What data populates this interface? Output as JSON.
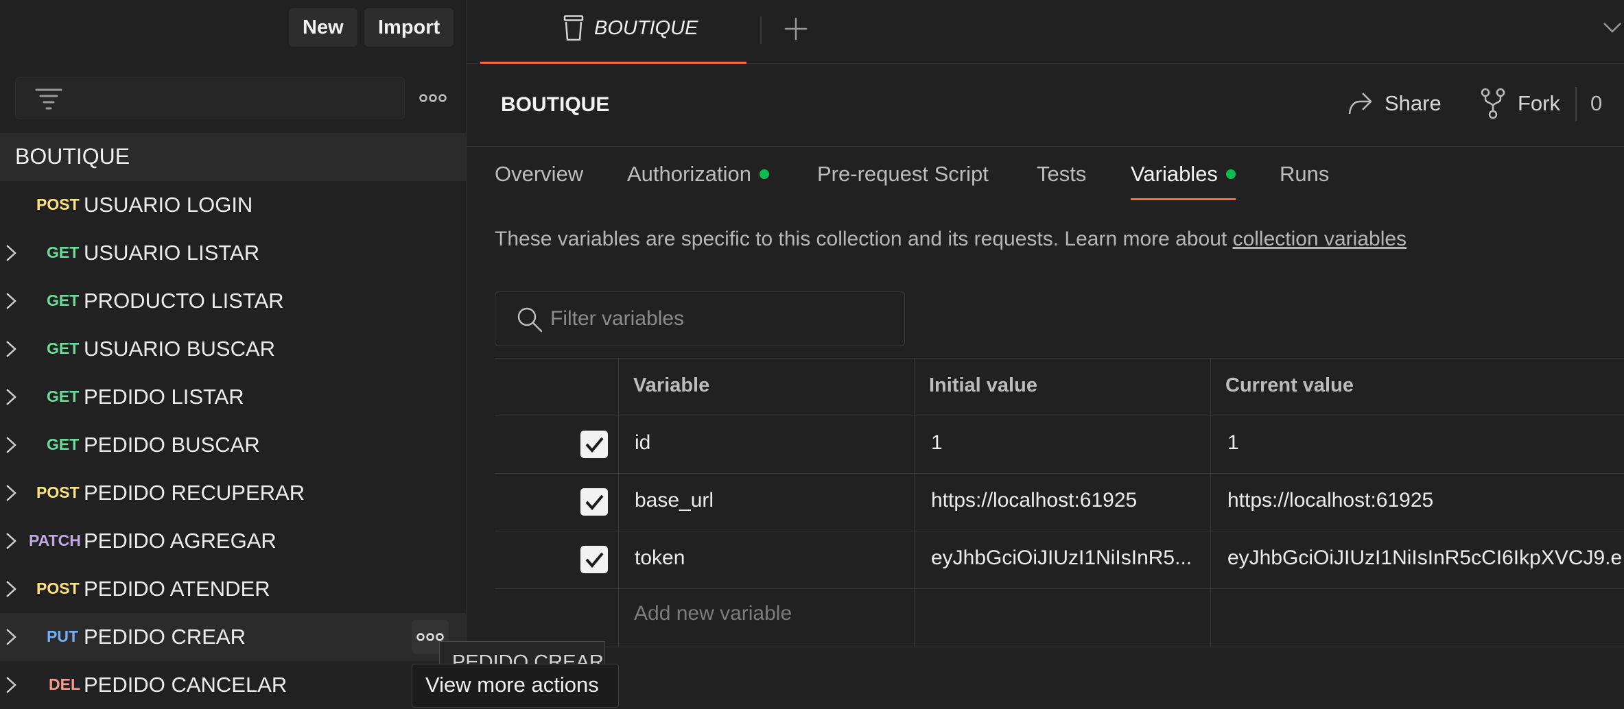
{
  "sidebar": {
    "new_label": "New",
    "import_label": "Import",
    "collection_name": "BOUTIQUE",
    "requests": [
      {
        "method": "POST",
        "name": "USUARIO LOGIN",
        "has_chevron": false
      },
      {
        "method": "GET",
        "name": "USUARIO LISTAR",
        "has_chevron": true
      },
      {
        "method": "GET",
        "name": "PRODUCTO LISTAR",
        "has_chevron": true
      },
      {
        "method": "GET",
        "name": "USUARIO BUSCAR",
        "has_chevron": true
      },
      {
        "method": "GET",
        "name": "PEDIDO LISTAR",
        "has_chevron": true
      },
      {
        "method": "GET",
        "name": "PEDIDO BUSCAR",
        "has_chevron": true
      },
      {
        "method": "POST",
        "name": "PEDIDO RECUPERAR",
        "has_chevron": true
      },
      {
        "method": "PATCH",
        "name": "PEDIDO AGREGAR",
        "has_chevron": true
      },
      {
        "method": "POST",
        "name": "PEDIDO ATENDER",
        "has_chevron": true
      },
      {
        "method": "PUT",
        "name": "PEDIDO CREAR",
        "has_chevron": true,
        "hovered": true
      },
      {
        "method": "DEL",
        "name": "PEDIDO CANCELAR",
        "has_chevron": true
      }
    ]
  },
  "tooltip": {
    "title": "PEDIDO CREAR",
    "text": "View more actions"
  },
  "tabs": {
    "active_label": "BOUTIQUE",
    "add_icon": "plus-icon"
  },
  "header": {
    "title": "BOUTIQUE",
    "share_label": "Share",
    "fork_label": "Fork",
    "fork_count": "0"
  },
  "subtabs": [
    {
      "label": "Overview",
      "dot": false,
      "active": false
    },
    {
      "label": "Authorization",
      "dot": true,
      "active": false
    },
    {
      "label": "Pre-request Script",
      "dot": false,
      "active": false
    },
    {
      "label": "Tests",
      "dot": false,
      "active": false
    },
    {
      "label": "Variables",
      "dot": true,
      "active": true
    },
    {
      "label": "Runs",
      "dot": false,
      "active": false
    }
  ],
  "variables_panel": {
    "description": "These variables are specific to this collection and its requests. Learn more about",
    "description_link": "collection variables",
    "filter_placeholder": "Filter variables",
    "columns": [
      "Variable",
      "Initial value",
      "Current value"
    ],
    "rows": [
      {
        "checked": true,
        "variable": "id",
        "initial": "1",
        "current": "1"
      },
      {
        "checked": true,
        "variable": "base_url",
        "initial": "https://localhost:61925",
        "current": "https://localhost:61925"
      },
      {
        "checked": true,
        "variable": "token",
        "initial": "eyJhbGciOiJIUzI1NiIsInR5...",
        "current": "eyJhbGciOiJIUzI1NiIsInR5cCI6IkpXVCJ9.e"
      }
    ],
    "add_placeholder": "Add new variable"
  },
  "colors": {
    "accent": "#ff6c37",
    "status_dot": "#0cbb52",
    "post": "#ffe47e",
    "get": "#6bdd9a",
    "patch": "#c0a8e1",
    "put": "#74aef6",
    "del": "#f79a8e"
  }
}
